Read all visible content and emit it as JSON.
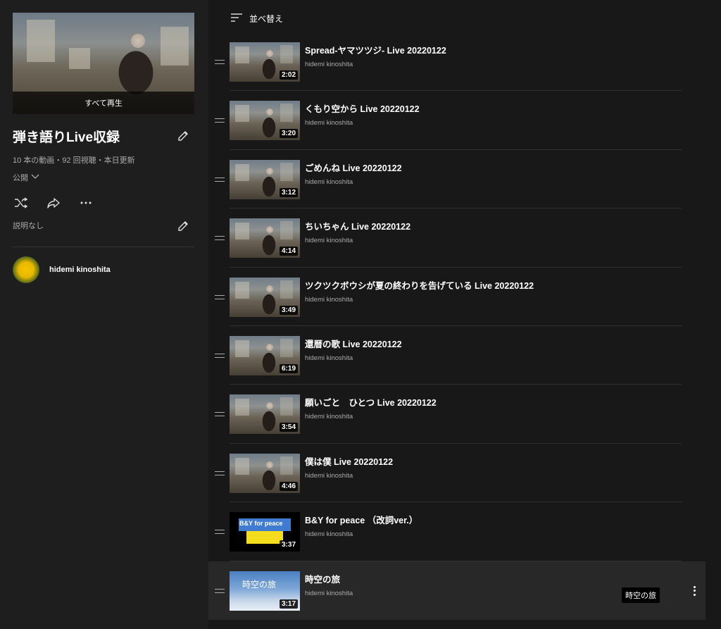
{
  "playlist": {
    "title": "弾き語りLive収録",
    "play_all": "すべて再生",
    "stats": "10 本の動画・92 回視聴・本日更新",
    "privacy": "公開",
    "description": "説明なし",
    "owner": "hidemi kinoshita"
  },
  "sort_label": "並べ替え",
  "videos": [
    {
      "title": "Spread-ヤマツツジ- Live 20220122",
      "channel": "hidemi kinoshita",
      "duration": "2:02"
    },
    {
      "title": "くもり空から Live 20220122",
      "channel": "hidemi kinoshita",
      "duration": "3:20"
    },
    {
      "title": "ごめんね Live 20220122",
      "channel": "hidemi kinoshita",
      "duration": "3:12"
    },
    {
      "title": "ちいちゃん Live 20220122",
      "channel": "hidemi kinoshita",
      "duration": "4:14"
    },
    {
      "title": "ツクツクボウシが夏の終わりを告げている Live 20220122",
      "channel": "hidemi kinoshita",
      "duration": "3:49"
    },
    {
      "title": "還暦の歌 Live 20220122",
      "channel": "hidemi kinoshita",
      "duration": "6:19"
    },
    {
      "title": "願いごと　ひとつ Live 20220122",
      "channel": "hidemi kinoshita",
      "duration": "3:54"
    },
    {
      "title": "僕は僕 Live 20220122",
      "channel": "hidemi kinoshita",
      "duration": "4:46"
    },
    {
      "title": "B&Y for peace （改詞ver.）",
      "channel": "hidemi kinoshita",
      "duration": "3:37",
      "thumb_text": "B&Y for peace"
    },
    {
      "title": "時空の旅",
      "channel": "hidemi kinoshita",
      "duration": "3:17",
      "thumb_text": "時空の旅",
      "tooltip": "時空の旅"
    }
  ]
}
